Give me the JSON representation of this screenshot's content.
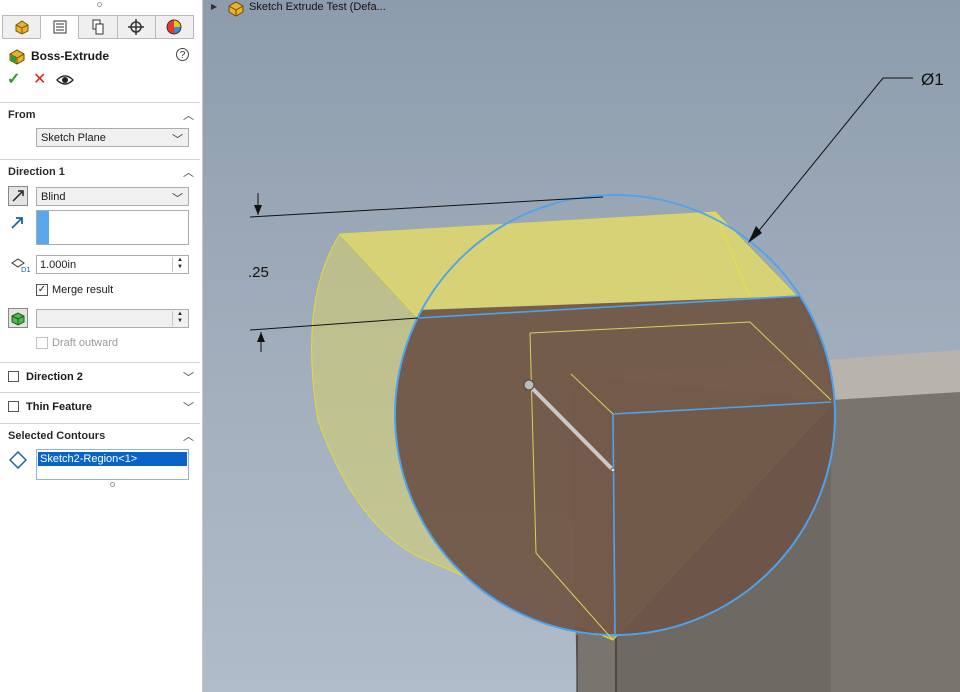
{
  "panel": {
    "tabs": [
      {
        "icon": "feature-manager-icon"
      },
      {
        "icon": "property-manager-icon"
      },
      {
        "icon": "configuration-manager-icon"
      },
      {
        "icon": "dimxpert-icon"
      },
      {
        "icon": "display-manager-icon"
      }
    ],
    "title": "Boss-Extrude",
    "help": "?",
    "actions": {
      "ok": "✓",
      "cancel": "✕",
      "preview": "eye-icon"
    },
    "from": {
      "label": "From",
      "value": "Sketch Plane"
    },
    "direction1": {
      "label": "Direction 1",
      "end_condition": "Blind",
      "depth": "1.000in",
      "merge_result": "Merge result",
      "merge_checked": true,
      "draft_outward": "Draft outward"
    },
    "direction2": {
      "label": "Direction 2"
    },
    "thin_feature": {
      "label": "Thin Feature"
    },
    "selected_contours": {
      "label": "Selected Contours",
      "items": [
        "Sketch2-Region<1>"
      ]
    }
  },
  "viewport": {
    "tree_label": "Sketch Extrude Test  (Defa...",
    "dimension_diameter": "Ø1",
    "dimension_height": ".25"
  },
  "colors": {
    "accent_blue": "#0a64c8",
    "cylinder_yellow": "#d4cf72",
    "cylinder_front": "#7a6156",
    "edge_blue": "#4da3ee"
  }
}
